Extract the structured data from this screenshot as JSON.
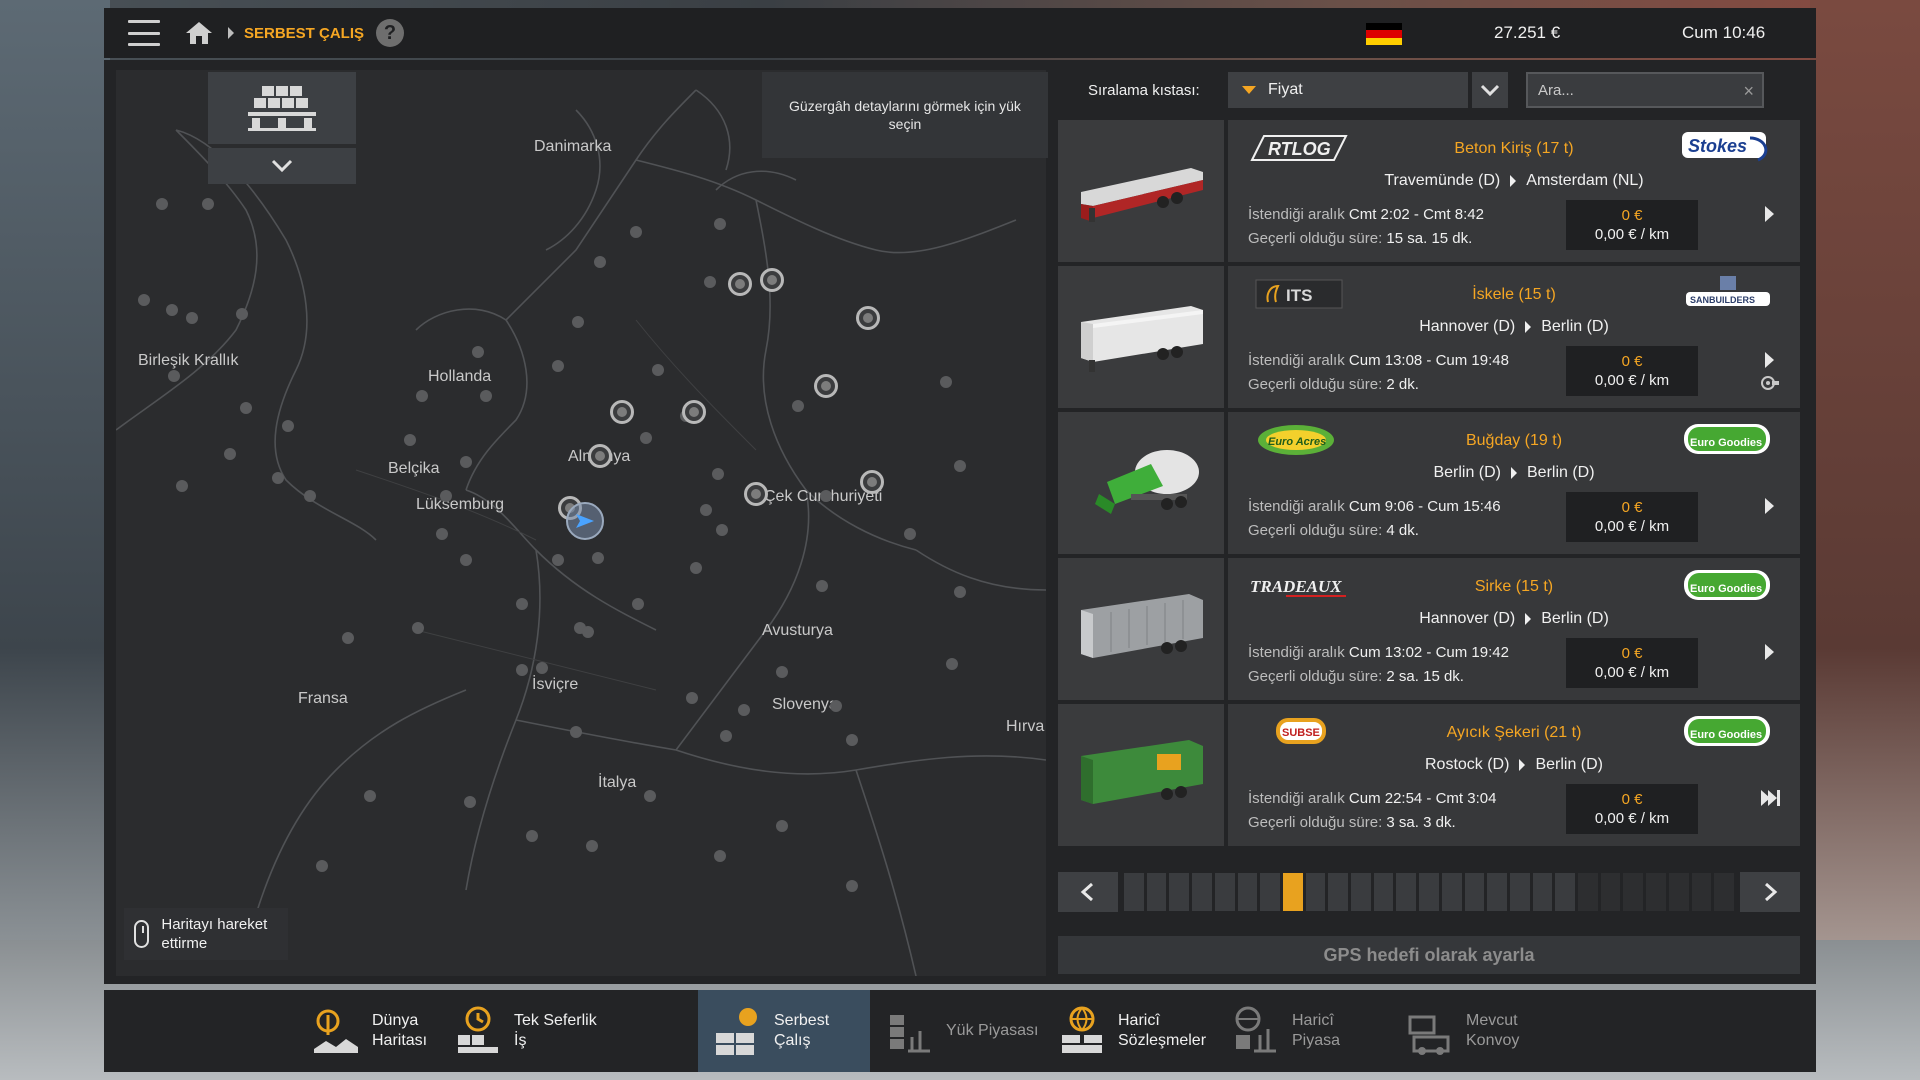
{
  "topbar": {
    "breadcrumb": "SERBEST ÇALIŞ",
    "help_glyph": "?",
    "money": "27.251 €",
    "clock": "Cum 10:46",
    "flag_colors": [
      "#000000",
      "#dd0000",
      "#ffce00"
    ]
  },
  "map": {
    "labels": {
      "danimarka": "Danimarka",
      "birlesik_krallik": "Birleşik Krallık",
      "hollanda": "Hollanda",
      "belcika": "Belçika",
      "luksemburg": "Lüksemburg",
      "almanya": "Almanya",
      "cek": "Çek Cumhuriyeti",
      "avusturya": "Avusturya",
      "isvicre": "İsviçre",
      "fransa": "Fransa",
      "slovenya": "Slovenya",
      "hirvatistan": "Hırva",
      "italya": "İtalya"
    },
    "tooltip": "Güzergâh detaylarını görmek için yük seçin",
    "hint": "Haritayı hareket ettirme"
  },
  "sort": {
    "label": "Sıralama kıstası:",
    "value": "Fiyat"
  },
  "search": {
    "placeholder": "Ara...",
    "clear_glyph": "×"
  },
  "jobs": [
    {
      "company_logo": "RTLOG",
      "client_logo": "Stokes",
      "cargo": "Beton Kiriş (17 t)",
      "from": "Travemünde (D)",
      "to": "Amsterdam (NL)",
      "window_label": "İstendiği aralık",
      "window": "Cmt 2:02 - Cmt 8:42",
      "valid_label": "Geçerli olduğu süre:",
      "valid": "15 sa. 15 dk.",
      "price": "0 €",
      "per_km": "0,00 € / km",
      "trailer": "flatbed-red"
    },
    {
      "company_logo": "ITS",
      "client_logo": "SANBUILDERS",
      "cargo": "İskele (15 t)",
      "from": "Hannover (D)",
      "to": "Berlin (D)",
      "window_label": "İstendiği aralık",
      "window": "Cum 13:08 - Cum 19:48",
      "valid_label": "Geçerli olduğu süre:",
      "valid": "2 dk.",
      "price": "0 €",
      "per_km": "0,00 € / km",
      "trailer": "box-white"
    },
    {
      "company_logo": "Euro Acres",
      "client_logo": "Euro Goodies",
      "cargo": "Buğday (19 t)",
      "from": "Berlin (D)",
      "to": "Berlin (D)",
      "window_label": "İstendiği aralık",
      "window": "Cum 9:06 - Cum 15:46",
      "valid_label": "Geçerli olduğu süre:",
      "valid": "4 dk.",
      "price": "0 €",
      "per_km": "0,00 € / km",
      "trailer": "silo-green"
    },
    {
      "company_logo": "TRADEAUX",
      "client_logo": "Euro Goodies",
      "cargo": "Sirke (15 t)",
      "from": "Hannover (D)",
      "to": "Berlin (D)",
      "window_label": "İstendiği aralık",
      "window": "Cum 13:02 - Cum 19:42",
      "valid_label": "Geçerli olduğu süre:",
      "valid": "2 sa. 15 dk.",
      "price": "0 €",
      "per_km": "0,00 € / km",
      "trailer": "curtain-grey"
    },
    {
      "company_logo": "SUBSE",
      "client_logo": "Euro Goodies",
      "cargo": "Ayıcık Şekeri (21 t)",
      "from": "Rostock (D)",
      "to": "Berlin (D)",
      "window_label": "İstendiği aralık",
      "window": "Cum 22:54 - Cmt 3:04",
      "valid_label": "Geçerli olduğu süre:",
      "valid": "3 sa. 3 dk.",
      "price": "0 €",
      "per_km": "0,00 € / km",
      "trailer": "curtain-green"
    }
  ],
  "pager": {
    "current_page": 8,
    "total_pages": 27,
    "bright_pages": 20
  },
  "gps_button": "GPS hedefi olarak ayarla",
  "bottomnav": [
    {
      "label1": "Dünya",
      "label2": "Haritası",
      "icon": "world-map-icon",
      "active": false,
      "dim": false
    },
    {
      "label1": "Tek Seferlik",
      "label2": "İş",
      "icon": "quick-job-icon",
      "active": false,
      "dim": false
    },
    {
      "label1": "Serbest",
      "label2": "Çalış",
      "icon": "freight-market-icon",
      "active": true,
      "dim": false
    },
    {
      "label1": "Yük Piyasası",
      "label2": "",
      "icon": "cargo-market-icon",
      "active": false,
      "dim": true
    },
    {
      "label1": "Haricî",
      "label2": "Sözleşmeler",
      "icon": "external-contracts-icon",
      "active": false,
      "dim": false
    },
    {
      "label1": "Haricî",
      "label2": "Piyasa",
      "icon": "external-market-icon",
      "active": false,
      "dim": true
    },
    {
      "label1": "Mevcut",
      "label2": "Konvoy",
      "icon": "convoy-icon",
      "active": false,
      "dim": true
    }
  ],
  "colors": {
    "accent": "#f5a623",
    "panel": "#232426",
    "card": "#37383a",
    "nav_active": "#3a4d5e"
  }
}
